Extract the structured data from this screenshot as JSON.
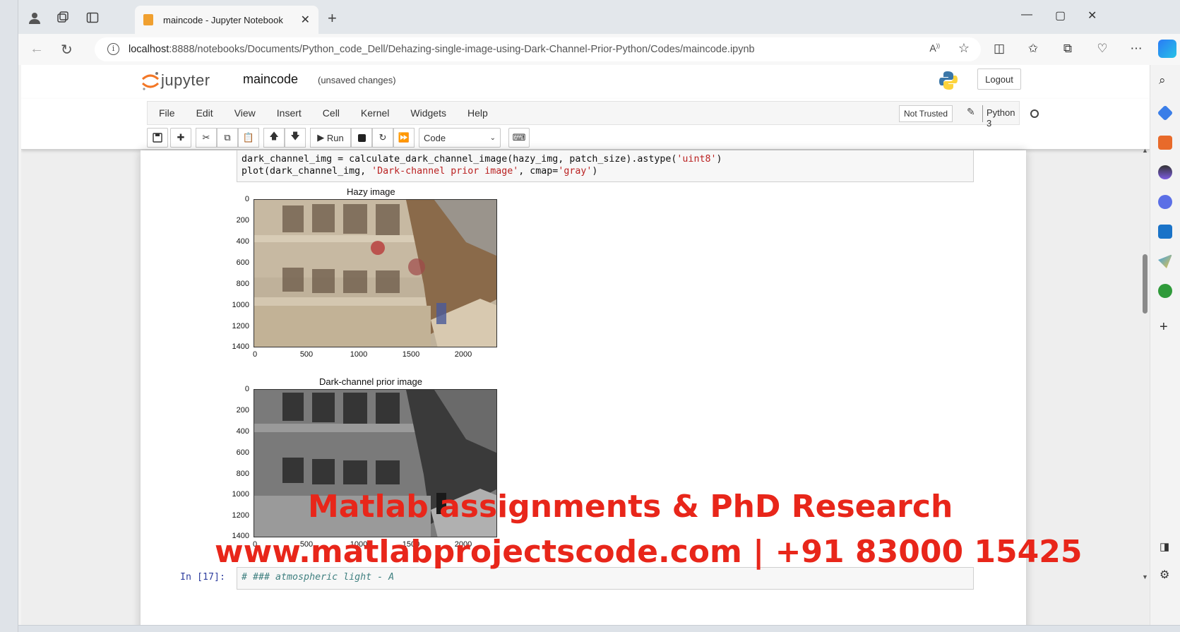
{
  "browser": {
    "tab_title": "maincode - Jupyter Notebook",
    "url_host": "localhost",
    "url_rest": ":8888/notebooks/Documents/Python_code_Dell/Dehazing-single-image-using-Dark-Channel-Prior-Python/Codes/maincode.ipynb"
  },
  "jupyter": {
    "logo_text": "jupyter",
    "notebook_name": "maincode",
    "save_status": "(unsaved changes)",
    "logout": "Logout",
    "menu": [
      "File",
      "Edit",
      "View",
      "Insert",
      "Cell",
      "Kernel",
      "Widgets",
      "Help"
    ],
    "trust": "Not Trusted",
    "kernel": "Python 3",
    "run_label": "Run",
    "cell_type": "Code"
  },
  "cells": {
    "code1_line1_a": "dark_channel_img = calculate_dark_channel_image(hazy_img, patch_size).astype(",
    "code1_line1_str": "'uint8'",
    "code1_line1_b": ")",
    "code1_line2_a": "plot(dark_channel_img, ",
    "code1_line2_str1": "'Dark-channel prior image'",
    "code1_line2_b": ", cmap=",
    "code1_line2_str2": "'gray'",
    "code1_line2_c": ")",
    "prompt2": "In [17]:",
    "code2": "# ### atmospheric light - A"
  },
  "plots": [
    {
      "title": "Hazy image",
      "yticks": [
        "0",
        "200",
        "400",
        "600",
        "800",
        "1000",
        "1200",
        "1400"
      ],
      "xticks": [
        "0",
        "500",
        "1000",
        "1500",
        "2000"
      ]
    },
    {
      "title": "Dark-channel prior image",
      "yticks": [
        "0",
        "200",
        "400",
        "600",
        "800",
        "1000",
        "1200",
        "1400"
      ],
      "xticks": [
        "0",
        "500",
        "1000",
        "1500",
        "2000"
      ]
    }
  ],
  "watermark": {
    "line1": "Matlab assignments & PhD Research",
    "line2": "www.matlabprojectscode.com | +91 83000 15425",
    "color": "#e8261a"
  }
}
